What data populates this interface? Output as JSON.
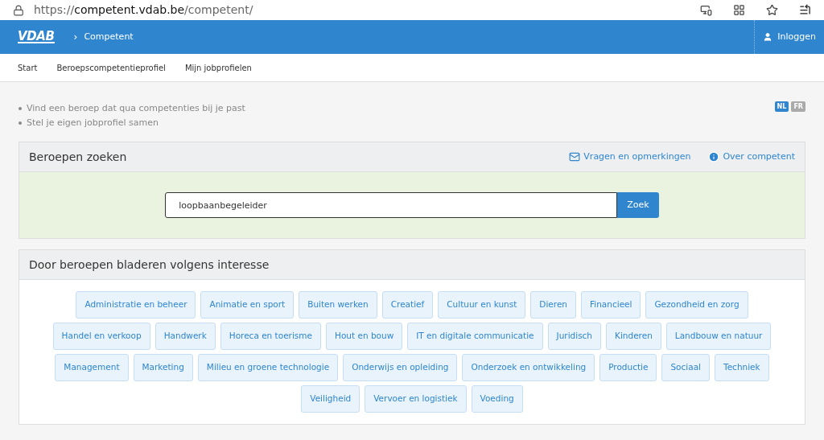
{
  "browser": {
    "url_scheme": "https://",
    "url_host": "competent.vdab.be",
    "url_path": "/competent/"
  },
  "header": {
    "logo": "VDAB",
    "breadcrumb_separator": "›",
    "breadcrumb": "Competent",
    "login": "Inloggen"
  },
  "nav": [
    "Start",
    "Beroepscompetentieprofiel",
    "Mijn jobprofielen"
  ],
  "intro": [
    "Vind een beroep dat qua competenties bij je past",
    "Stel je eigen jobprofiel samen"
  ],
  "languages": [
    {
      "label": "NL",
      "selected": true
    },
    {
      "label": "FR",
      "selected": false
    }
  ],
  "search_panel": {
    "title": "Beroepen zoeken",
    "links": [
      {
        "kind": "mail",
        "label": "Vragen en opmerkingen"
      },
      {
        "kind": "info",
        "label": "Over competent"
      }
    ],
    "value": "loopbaanbegeleider",
    "button": "Zoek"
  },
  "browse_panel": {
    "title": "Door beroepen bladeren volgens interesse",
    "interests": [
      "Administratie en beheer",
      "Animatie en sport",
      "Buiten werken",
      "Creatief",
      "Cultuur en kunst",
      "Dieren",
      "Financieel",
      "Gezondheid en zorg",
      "Handel en verkoop",
      "Handwerk",
      "Horeca en toerisme",
      "Hout en bouw",
      "IT en digitale communicatie",
      "Juridisch",
      "Kinderen",
      "Landbouw en natuur",
      "Management",
      "Marketing",
      "Milieu en groene technologie",
      "Onderwijs en opleiding",
      "Onderzoek en ontwikkeling",
      "Productie",
      "Sociaal",
      "Techniek",
      "Veiligheid",
      "Vervoer en logistiek",
      "Voeding"
    ]
  }
}
